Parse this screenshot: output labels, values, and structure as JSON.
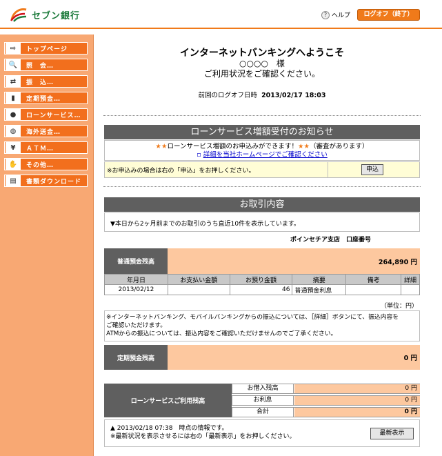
{
  "header": {
    "logo_text": "セブン銀行",
    "help_label": "ヘルプ",
    "logout_label": "ログオフ（終了）"
  },
  "sidebar": {
    "items": [
      {
        "label": "トップページ",
        "icon": "home-icon"
      },
      {
        "label": "照　会…",
        "icon": "magnifier-icon"
      },
      {
        "label": "振　込…",
        "icon": "transfer-icon"
      },
      {
        "label": "定期預金…",
        "icon": "bar-chart-icon"
      },
      {
        "label": "ローンサービス…",
        "icon": "coin-bag-icon"
      },
      {
        "label": "海外送金…",
        "icon": "globe-icon"
      },
      {
        "label": "ＡＴＭ…",
        "icon": "atm-icon"
      },
      {
        "label": "その他…",
        "icon": "hand-icon"
      },
      {
        "label": "書類ダウンロード",
        "icon": "document-icon"
      }
    ]
  },
  "welcome": {
    "title": "インターネットバンキングへようこそ",
    "name": "○○○○　様",
    "message": "ご利用状況をご確認ください。",
    "last_logoff_label": "前回のログオフ日時",
    "last_logoff_value": "2013/02/17 18:03"
  },
  "loan_notice": {
    "title": "ローンサービス増額受付のお知らせ",
    "star_left": "★★",
    "line1": "ローンサービス増額のお申込みができます！",
    "star_right": "★★",
    "line1_suffix": "（審査があります）",
    "link_text": "詳細を当社ホームページでご確認ください",
    "apply_note": "※お申込みの場合は右の「申込」をお押しください。",
    "apply_button": "申込"
  },
  "transactions": {
    "title": "お取引内容",
    "info": "▼本日から2ヶ月前までのお取引のうち直近10件を表示しています。",
    "branch": "ポインセチア支店　口座番号",
    "ordinary_label": "普通預金残高",
    "ordinary_value": "264,890 円",
    "columns": [
      "年月日",
      "お支払い金額",
      "お預り金額",
      "摘要",
      "備考",
      "詳細"
    ],
    "rows": [
      [
        "2013/02/12",
        "",
        "46",
        "普通預金利息",
        "",
        ""
      ]
    ],
    "unit": "（単位：円）",
    "note_lines": [
      "※インターネットバンキング、モバイルバンキングからの振込については、［詳細］ボタンにて、振込内容を",
      "ご確認いただけます。",
      "ATMからの振込については、振込内容をご確認いただけませんのでご了承ください。"
    ],
    "time_deposit_label": "定期預金残高",
    "time_deposit_value": "0 円",
    "loan_label": "ローンサービスご利用残高",
    "loan_rows": [
      {
        "label": "お借入残高",
        "value": "0 円"
      },
      {
        "label": "お利息",
        "value": "0 円"
      },
      {
        "label": "合計",
        "value": "0 円"
      }
    ],
    "footer_line1": "▲ 2013/02/18 07:38　時点の情報です。",
    "footer_line2": "※最新状況を表示させるには右の「最新表示」をお押しください。",
    "refresh_button": "最新表示"
  },
  "colors": {
    "accent": "#f07a1a",
    "sidebar_bg": "#f8a873",
    "panel_header": "#5f5f5f",
    "balance_bg": "#fdc89f"
  }
}
